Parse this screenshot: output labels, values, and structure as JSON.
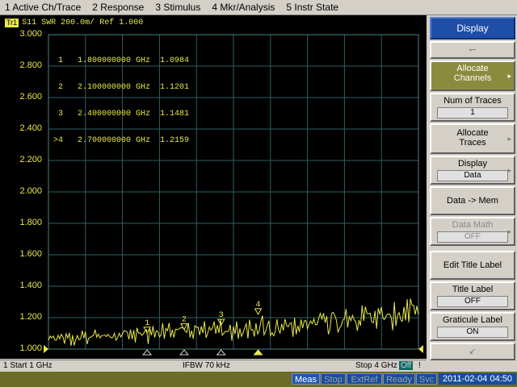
{
  "menu": [
    "1 Active Ch/Trace",
    "2 Response",
    "3 Stimulus",
    "4 Mkr/Analysis",
    "5 Instr State"
  ],
  "trace": {
    "badge": "Tr1",
    "header": "S11  SWR 200.0m/ Ref 1.000"
  },
  "markers_table": [
    " 1   1.800000000 GHz  1.0984",
    " 2   2.100000000 GHz  1.1201",
    " 3   2.400000000 GHz  1.1481",
    ">4   2.700000000 GHz  1.2159"
  ],
  "status": {
    "start": "1  Start 1 GHz",
    "ifbw": "IFBW 70 kHz",
    "stop": "Stop 4 GHz",
    "off": "Off",
    "channel": "!"
  },
  "bottom": {
    "meas": "Meas",
    "stop": "Stop",
    "extref": "ExtRef",
    "ready": "Ready",
    "svc": "Svc",
    "datetime": "2011-02-04 04:50"
  },
  "softkeys": {
    "title": "Display",
    "allocate_channels": "Allocate Channels",
    "num_traces_label": "Num of Traces",
    "num_traces_value": "1",
    "allocate_traces": "Allocate Traces",
    "display_label": "Display",
    "display_value": "Data",
    "data_to_mem": "Data -> Mem",
    "data_math_label": "Data Math",
    "data_math_value": "OFF",
    "edit_title_label": "Edit Title Label",
    "title_label_label": "Title Label",
    "title_label_value": "OFF",
    "graticule_label_label": "Graticule Label",
    "graticule_label_value": "ON"
  },
  "colors": {
    "trace": "#e8e84a",
    "grid": "#2f5f5f",
    "background": "#000000"
  },
  "chart_data": {
    "type": "line",
    "x_unit": "GHz",
    "xlim": [
      1,
      4
    ],
    "ylim": [
      1.0,
      3.0
    ],
    "yticks": [
      "3.000",
      "2.800",
      "2.600",
      "2.400",
      "2.200",
      "2.000",
      "1.800",
      "1.600",
      "1.400",
      "1.200",
      "1.000"
    ],
    "markers": [
      {
        "label": "1",
        "x": 1.8,
        "y": 1.0984
      },
      {
        "label": "2",
        "x": 2.1,
        "y": 1.1201
      },
      {
        "label": "3",
        "x": 2.4,
        "y": 1.1481
      },
      {
        "label": "4",
        "x": 2.7,
        "y": 1.2159
      }
    ]
  }
}
